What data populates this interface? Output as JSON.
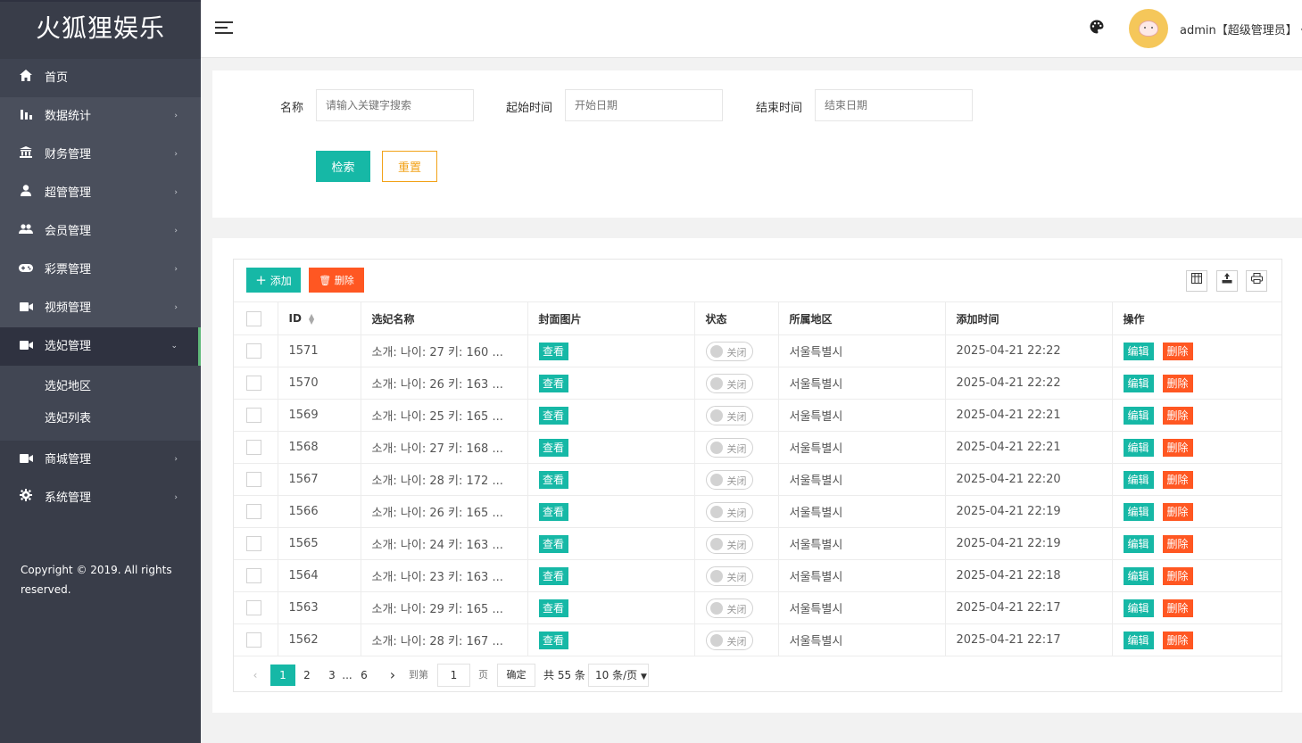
{
  "app": {
    "logo": "火狐狸娱乐"
  },
  "sidebar": {
    "items": [
      {
        "label": "首页",
        "icon": "home-icon"
      },
      {
        "label": "数据统计",
        "icon": "bar-chart-icon"
      },
      {
        "label": "财务管理",
        "icon": "bank-icon"
      },
      {
        "label": "超管管理",
        "icon": "user-icon"
      },
      {
        "label": "会员管理",
        "icon": "users-icon"
      },
      {
        "label": "彩票管理",
        "icon": "gamepad-icon"
      },
      {
        "label": "视频管理",
        "icon": "video-icon"
      },
      {
        "label": "选妃管理",
        "icon": "video-icon"
      },
      {
        "label": "商城管理",
        "icon": "video-icon"
      },
      {
        "label": "系统管理",
        "icon": "gear-icon"
      }
    ],
    "subitems": [
      "选妃地区",
      "选妃列表"
    ],
    "copyright": "Copyright © 2019. All rights reserved."
  },
  "header": {
    "user": "admin【超级管理员】"
  },
  "search": {
    "name_label": "名称",
    "name_placeholder": "请输入关键字搜索",
    "start_label": "起始时间",
    "start_placeholder": "开始日期",
    "end_label": "结束时间",
    "end_placeholder": "结束日期",
    "search_btn": "检索",
    "reset_btn": "重置"
  },
  "toolbar": {
    "add": "添加",
    "delete": "删除"
  },
  "table": {
    "headers": [
      "ID",
      "选妃名称",
      "封面图片",
      "状态",
      "所属地区",
      "添加时间",
      "操作"
    ],
    "view_label": "查看",
    "status_off": "关闭",
    "edit_label": "编辑",
    "delete_label": "删除",
    "rows": [
      {
        "id": "1571",
        "name": "소개: 나이: 27 키: 160 ...",
        "region": "서울특별시",
        "time": "2025-04-21 22:22"
      },
      {
        "id": "1570",
        "name": "소개: 나이: 26 키: 163 ...",
        "region": "서울특별시",
        "time": "2025-04-21 22:22"
      },
      {
        "id": "1569",
        "name": "소개: 나이: 25 키: 165 ...",
        "region": "서울특별시",
        "time": "2025-04-21 22:21"
      },
      {
        "id": "1568",
        "name": "소개: 나이: 27 키: 168 ...",
        "region": "서울특별시",
        "time": "2025-04-21 22:21"
      },
      {
        "id": "1567",
        "name": "소개: 나이: 28 키: 172 ...",
        "region": "서울특별시",
        "time": "2025-04-21 22:20"
      },
      {
        "id": "1566",
        "name": "소개: 나이: 26 키: 165 ...",
        "region": "서울특별시",
        "time": "2025-04-21 22:19"
      },
      {
        "id": "1565",
        "name": "소개: 나이: 24 키: 163 ...",
        "region": "서울특별시",
        "time": "2025-04-21 22:19"
      },
      {
        "id": "1564",
        "name": "소개: 나이: 23 키: 163 ...",
        "region": "서울특별시",
        "time": "2025-04-21 22:18"
      },
      {
        "id": "1563",
        "name": "소개: 나이: 29 키: 165 ...",
        "region": "서울특별시",
        "time": "2025-04-21 22:17"
      },
      {
        "id": "1562",
        "name": "소개: 나이: 28 키: 167 ...",
        "region": "서울특별시",
        "time": "2025-04-21 22:17"
      }
    ]
  },
  "pagination": {
    "current": "1",
    "pages": [
      "2",
      "3"
    ],
    "ellipsis": "...",
    "last": "6",
    "goto_label": "到第",
    "goto_value": "1",
    "page_unit": "页",
    "confirm": "确定",
    "total": "共 55 条",
    "page_size": "10 条/页"
  },
  "colors": {
    "accent": "#16b8a6",
    "danger": "#ff5722",
    "warning": "#f2a218",
    "sidebar": "#393d49"
  }
}
